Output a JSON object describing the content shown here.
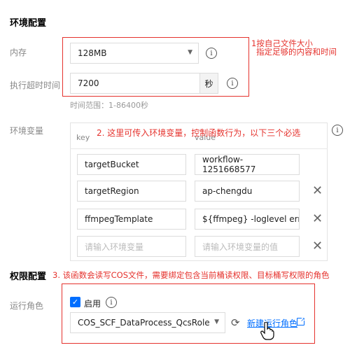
{
  "sections": {
    "env_config": "环境配置",
    "permission_config": "权限配置"
  },
  "memory": {
    "label": "内存",
    "value": "128MB"
  },
  "timeout": {
    "label": "执行超时时间",
    "value": "7200",
    "unit": "秒",
    "hint": "时间范围：1-86400秒"
  },
  "env_vars": {
    "label": "环境变量",
    "key_header": "key",
    "value_header": "value",
    "rows": [
      {
        "key": "targetBucket",
        "value": "workflow-1251668577"
      },
      {
        "key": "targetRegion",
        "value": "ap-chengdu"
      },
      {
        "key": "ffmpegTemplate",
        "value": "${ffmpeg} -loglevel error -i"
      }
    ],
    "key_placeholder": "请输入环境变量",
    "value_placeholder": "请输入环境变量的值"
  },
  "role": {
    "label": "运行角色",
    "enable_label": "启用",
    "selected": "COS_SCF_DataProcess_QcsRole",
    "new_role_link": "新建运行角色"
  },
  "annotations": {
    "a1_line1": "1按自己文件大小",
    "a1_line2": "指定足够的内容和时间",
    "a2": "2. 这里可传入环境变量，控制函数行为，以下三个必选",
    "a3": "3. 该函数会读写COS文件，需要绑定包含当前桶读权限、目标桶写权限的角色"
  },
  "colors": {
    "annotation_red": "#e5322d",
    "checkbox_blue": "#006eff",
    "link_blue": "#006eff"
  }
}
